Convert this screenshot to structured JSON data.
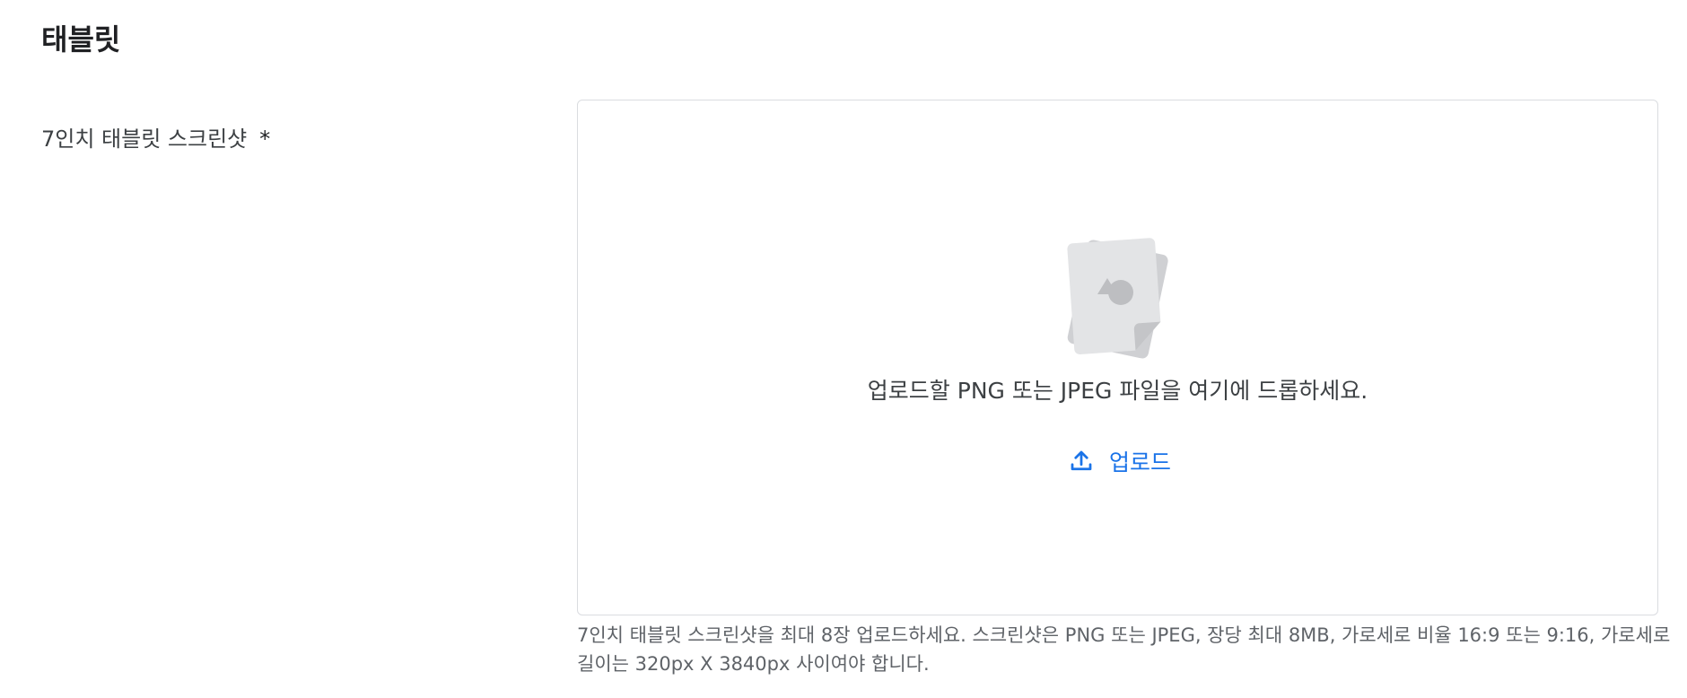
{
  "section": {
    "title": "태블릿"
  },
  "field": {
    "label": "7인치 태블릿 스크린샷",
    "required_marker": "*"
  },
  "dropzone": {
    "icon": "image-file-stack-icon",
    "drop_text": "업로드할 PNG 또는 JPEG 파일을 여기에 드롭하세요.",
    "upload_icon": "upload-icon",
    "upload_label": "업로드"
  },
  "helper": {
    "text": "7인치 태블릿 스크린샷을 최대 8장 업로드하세요. 스크린샷은 PNG 또는 JPEG, 장당 최대 8MB, 가로세로 비율 16:9 또는 9:16, 가로세로 길이는 320px X 3840px 사이여야 합니다."
  },
  "colors": {
    "accent": "#1a73e8",
    "border": "#dadce0",
    "text_primary": "#202124",
    "text_secondary": "#5f6368"
  }
}
